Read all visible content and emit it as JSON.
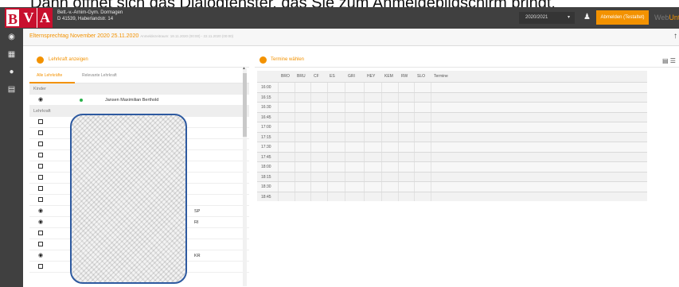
{
  "caption": "Dann öffnet sich das Dialogfenster, das Sie zum Anmeldebildschirm bringt.",
  "header": {
    "logo_letters": [
      "B",
      "V",
      "A"
    ],
    "school_name": "Bett.-v.-Arnim-Gym. Dormagen",
    "school_address": "D 41539, Haberlandstr. 14",
    "school_year": "2020/2021",
    "logout_label": "Abmelden (Testaltet)",
    "brand_web": "Web",
    "brand_untis": "Untis"
  },
  "page": {
    "title": "Elternsprechtag November 2020 25.11.2020",
    "subtitle": "Anmeldezeitraum: 18.11.2020 (00:00) - 22.11.2020 (00:00)"
  },
  "left_panel": {
    "heading": "Lehrkraft anzeigen",
    "tabs": [
      "Alle Lehrkräfte",
      "Relevante Lehrkraft"
    ],
    "section_children": "Kinder",
    "child_name": "Jansen Maximilian Berthold",
    "section_teachers": "Lehrkraft",
    "teacher_subjects": [
      "",
      "",
      "",
      "",
      "",
      "",
      "",
      "",
      "SP",
      "RI",
      "",
      "",
      "KR",
      ""
    ]
  },
  "right_panel": {
    "heading": "Termine wählen",
    "columns": [
      "BRO",
      "BRU",
      "CF",
      "ES",
      "GRI",
      "HEY",
      "KEM",
      "RW",
      "SLO",
      "Termine"
    ],
    "times": [
      "16:00",
      "16:15",
      "16:30",
      "16:45",
      "17:00",
      "17:15",
      "17:30",
      "17:45",
      "18:00",
      "18:15",
      "18:30",
      "18:45"
    ]
  },
  "colors": {
    "accent": "#f39200",
    "topbar": "#404040",
    "brand_red": "#c8102e",
    "online_dot": "#2bb24c"
  },
  "icons": {
    "sidebar": [
      "dashboard-icon",
      "calendar-icon",
      "messages-icon",
      "book-icon"
    ],
    "row_eye": "eye-icon",
    "row_checkbox": "checkbox-icon"
  }
}
